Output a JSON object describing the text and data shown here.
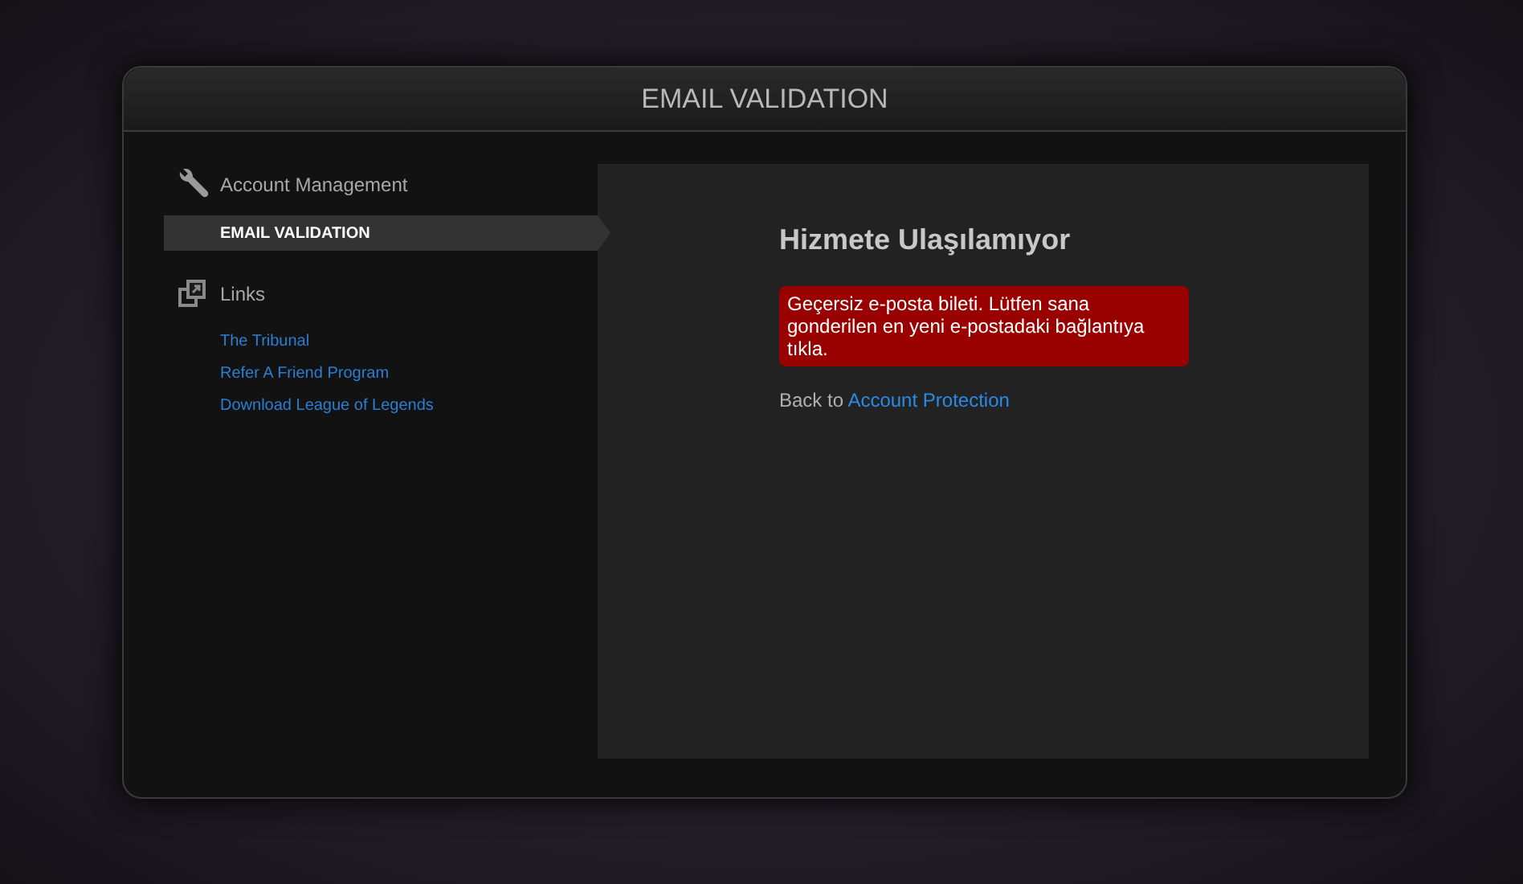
{
  "window": {
    "title": "EMAIL VALIDATION"
  },
  "sidebar": {
    "sections": [
      {
        "title": "Account Management",
        "items": [
          {
            "label": "EMAIL VALIDATION",
            "selected": true
          }
        ]
      },
      {
        "title": "Links",
        "items": [
          {
            "label": "The Tribunal",
            "selected": false
          },
          {
            "label": "Refer A Friend Program",
            "selected": false
          },
          {
            "label": "Download League of Legends",
            "selected": false
          }
        ]
      }
    ]
  },
  "content": {
    "heading": "Hizmete Ulaşılamıyor",
    "error": "Geçersiz e-posta bileti. Lütfen sana gonderilen en yeni e-postadaki bağlantıya tıkla.",
    "back_text": "Back to",
    "back_link": "Account Protection"
  }
}
